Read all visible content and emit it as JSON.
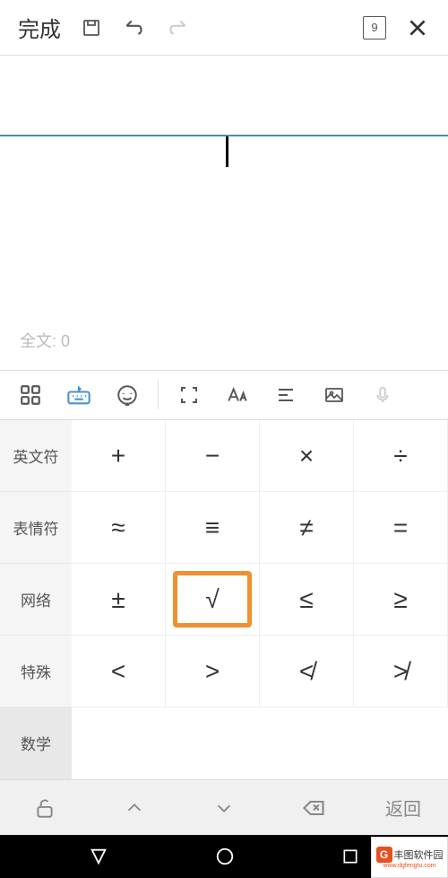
{
  "topbar": {
    "done": "完成",
    "page": "9"
  },
  "wordcount": "全文: 0",
  "tabs": {
    "english": "英文符",
    "emoji": "表情符",
    "network": "网络",
    "special": "特殊",
    "math": "数学"
  },
  "keys": {
    "r0c0": "+",
    "r0c1": "−",
    "r0c2": "×",
    "r0c3": "÷",
    "r1c0": "≈",
    "r1c1": "≡",
    "r1c2": "≠",
    "r1c3": "=",
    "r2c0": "±",
    "r2c1": "√",
    "r2c2": "≤",
    "r2c3": "≥",
    "r3c0": "<",
    "r3c1": ">",
    "r3c2": "≮",
    "r3c3": "≯"
  },
  "bottom": {
    "back": "返回"
  },
  "watermark": {
    "logo": "G",
    "name": "丰图软件园",
    "url": "www.dgfengtu.com"
  }
}
